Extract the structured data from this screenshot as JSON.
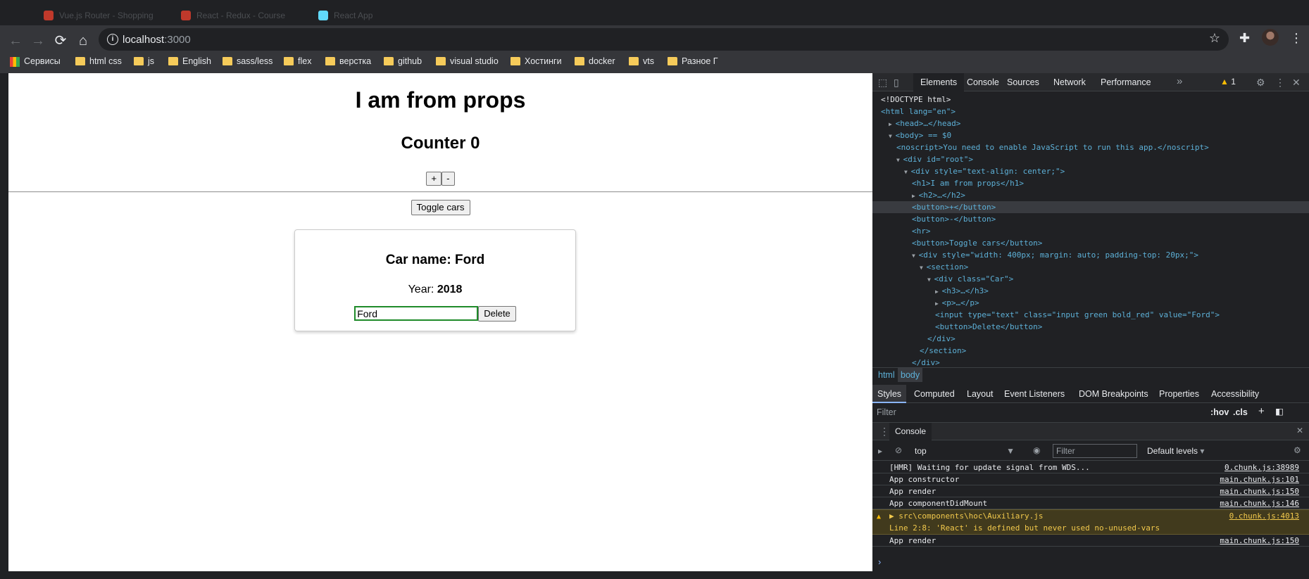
{
  "browser": {
    "tabs": [
      {
        "label": "Vue.js Router - Shopping"
      },
      {
        "label": "React - Redux - Course"
      },
      {
        "label": "React App"
      }
    ],
    "url_host": "localhost",
    "url_port": ":3000",
    "bookmarks": [
      "Сервисы",
      "html css",
      "js",
      "English",
      "sass/less",
      "flex",
      "верстка",
      "github",
      "visual studio",
      "Хостинги",
      "docker",
      "vts",
      "Разное Г"
    ]
  },
  "app": {
    "title": "I am from props",
    "counter_label": "Counter 0",
    "plus_label": "+",
    "minus_label": "-",
    "toggle_label": "Toggle cars",
    "car": {
      "name_label": "Car name: Ford",
      "year_prefix": "Year: ",
      "year_value": "2018",
      "input_value": "Ford",
      "delete_label": "Delete"
    }
  },
  "devtools": {
    "tabs": [
      "Elements",
      "Console",
      "Sources",
      "Network",
      "Performance"
    ],
    "more": "»",
    "warnings": "1",
    "tree": [
      {
        "i": 0,
        "t": "<!DOCTYPE html>",
        "c": "txt"
      },
      {
        "i": 0,
        "t": "<html lang=\"en\">",
        "c": "tag"
      },
      {
        "i": 1,
        "t": "<head>…</head>",
        "c": "tag",
        "arrow": "▶"
      },
      {
        "i": 1,
        "t": "<body> == $0",
        "c": "tag",
        "arrow": "▼"
      },
      {
        "i": 2,
        "t": "<noscript>You need to enable JavaScript to run this app.</noscript>",
        "c": "tag"
      },
      {
        "i": 2,
        "t": "<div id=\"root\">",
        "c": "tag",
        "arrow": "▼"
      },
      {
        "i": 3,
        "t": "<div style=\"text-align: center;\">",
        "c": "tag",
        "arrow": "▼"
      },
      {
        "i": 4,
        "t": "<h1>I am from props</h1>",
        "c": "tag"
      },
      {
        "i": 4,
        "t": "<h2>…</h2>",
        "c": "tag",
        "arrow": "▶"
      },
      {
        "i": 4,
        "t": "<button>+</button>",
        "c": "tag"
      },
      {
        "i": 4,
        "t": "<button>-</button>",
        "c": "tag"
      },
      {
        "i": 4,
        "t": "<hr>",
        "c": "tag"
      },
      {
        "i": 4,
        "t": "<button>Toggle cars</button>",
        "c": "tag"
      },
      {
        "i": 4,
        "t": "<div style=\"width: 400px; margin: auto; padding-top: 20px;\">",
        "c": "tag",
        "arrow": "▼"
      },
      {
        "i": 5,
        "t": "<section>",
        "c": "tag",
        "arrow": "▼"
      },
      {
        "i": 6,
        "t": "<div class=\"Car\">",
        "c": "tag",
        "arrow": "▼"
      },
      {
        "i": 7,
        "t": "<h3>…</h3>",
        "c": "tag",
        "arrow": "▶"
      },
      {
        "i": 7,
        "t": "<p>…</p>",
        "c": "tag",
        "arrow": "▶"
      },
      {
        "i": 7,
        "t": "<input type=\"text\" class=\"input green bold_red\" value=\"Ford\">",
        "c": "tag"
      },
      {
        "i": 7,
        "t": "<button>Delete</button>",
        "c": "tag"
      },
      {
        "i": 6,
        "t": "</div>",
        "c": "tag"
      },
      {
        "i": 5,
        "t": "</section>",
        "c": "tag"
      },
      {
        "i": 4,
        "t": "</div>",
        "c": "tag"
      }
    ],
    "breadcrumbs": [
      "html",
      "body"
    ],
    "styles_tabs": [
      "Styles",
      "Computed",
      "Layout",
      "Event Listeners",
      "DOM Breakpoints",
      "Properties",
      "Accessibility"
    ],
    "styles_filter_placeholder": "Filter",
    "styles_hov": ":hov",
    "styles_cls": ".cls",
    "console_tab": "Console",
    "context": "top",
    "console_filter_placeholder": "Filter",
    "levels": "Default levels",
    "logs": [
      {
        "msg": "[HMR] Waiting for update signal from WDS...",
        "src": "0.chunk.js:38989",
        "warn": false
      },
      {
        "msg": "App constructor",
        "src": "main.chunk.js:101",
        "warn": false
      },
      {
        "msg": "App render",
        "src": "main.chunk.js:150",
        "warn": false
      },
      {
        "msg": "App componentDidMount",
        "src": "main.chunk.js:146",
        "warn": false
      },
      {
        "msg": "▶ src\\components\\hoc\\Auxiliary.js",
        "msg2": "Line 2:8:  'React' is defined but never used  no-unused-vars",
        "src": "0.chunk.js:4013",
        "warn": true
      },
      {
        "msg": "App render",
        "src": "main.chunk.js:150",
        "warn": false
      }
    ],
    "prompt": "›"
  }
}
